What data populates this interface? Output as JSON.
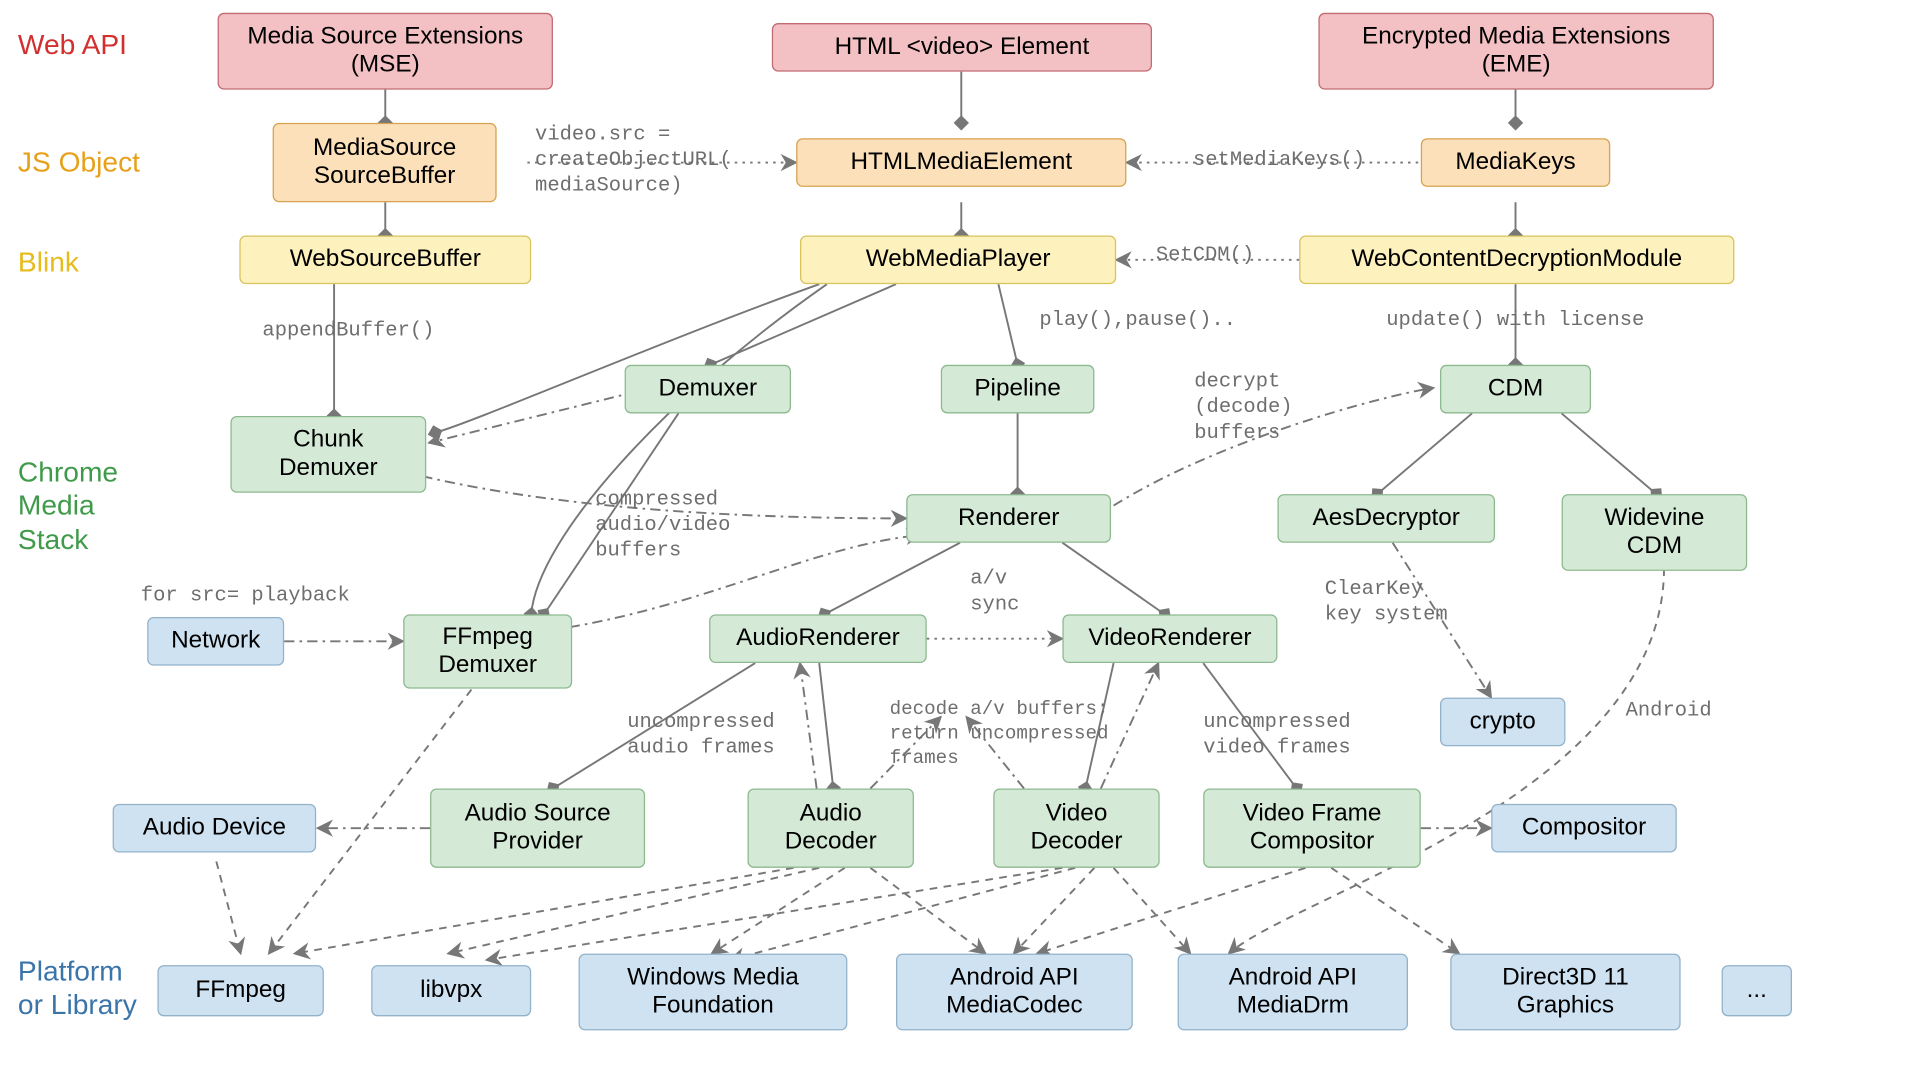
{
  "rows": {
    "webapi": "Web API",
    "jsobj": "JS Object",
    "blink": "Blink",
    "chrome": "Chrome\nMedia\nStack",
    "platform": "Platform\nor Library"
  },
  "boxes": {
    "mse": "Media Source Extensions\n(MSE)",
    "video_el": "HTML <video> Element",
    "eme": "Encrypted Media Extensions\n(EME)",
    "msrc": "MediaSource\nSourceBuffer",
    "hme": "HTMLMediaElement",
    "mkeys": "MediaKeys",
    "wsb": "WebSourceBuffer",
    "wmp": "WebMediaPlayer",
    "wcd": "WebContentDecryptionModule",
    "chunk": "Chunk\nDemuxer",
    "demux": "Demuxer",
    "pipe": "Pipeline",
    "cdm": "CDM",
    "renderer": "Renderer",
    "aes": "AesDecryptor",
    "widevine": "Widevine\nCDM",
    "audr": "AudioRenderer",
    "vidr": "VideoRenderer",
    "network": "Network",
    "ffdm": "FFmpeg\nDemuxer",
    "crypto": "crypto",
    "adev": "Audio Device",
    "aspr": "Audio Source\nProvider",
    "adec": "Audio\nDecoder",
    "vdec": "Video\nDecoder",
    "vfcomp": "Video Frame\nCompositor",
    "comp": "Compositor",
    "ffmpeg": "FFmpeg",
    "libvpx": "libvpx",
    "wmf": "Windows Media\nFoundation",
    "amc": "Android API\nMediaCodec",
    "adrm": "Android API\nMediaDrm",
    "d3d": "Direct3D 11\nGraphics",
    "dots": "..."
  },
  "edge_labels": {
    "video_src": "video.src =\ncreateObjectURL(\nmediaSource)",
    "setmk": "setMediaKeys()",
    "setcdm": "SetCDM()",
    "appendbuf": "appendBuffer()",
    "playpause": "play(),pause()..",
    "updatelic": "update() with license",
    "compressed": "compressed\naudio/video\nbuffers",
    "decrypt": "decrypt\n(decode)\nbuffers",
    "avsync": "a/v\nsync",
    "forsrc": "for src= playback",
    "clearkey": "ClearKey\nkey system",
    "uncomp_audio": "uncompressed\naudio frames",
    "decode_av": "decode a/v buffers;\nreturn uncompressed\nframes",
    "uncomp_video": "uncompressed\nvideo frames",
    "android": "Android"
  }
}
